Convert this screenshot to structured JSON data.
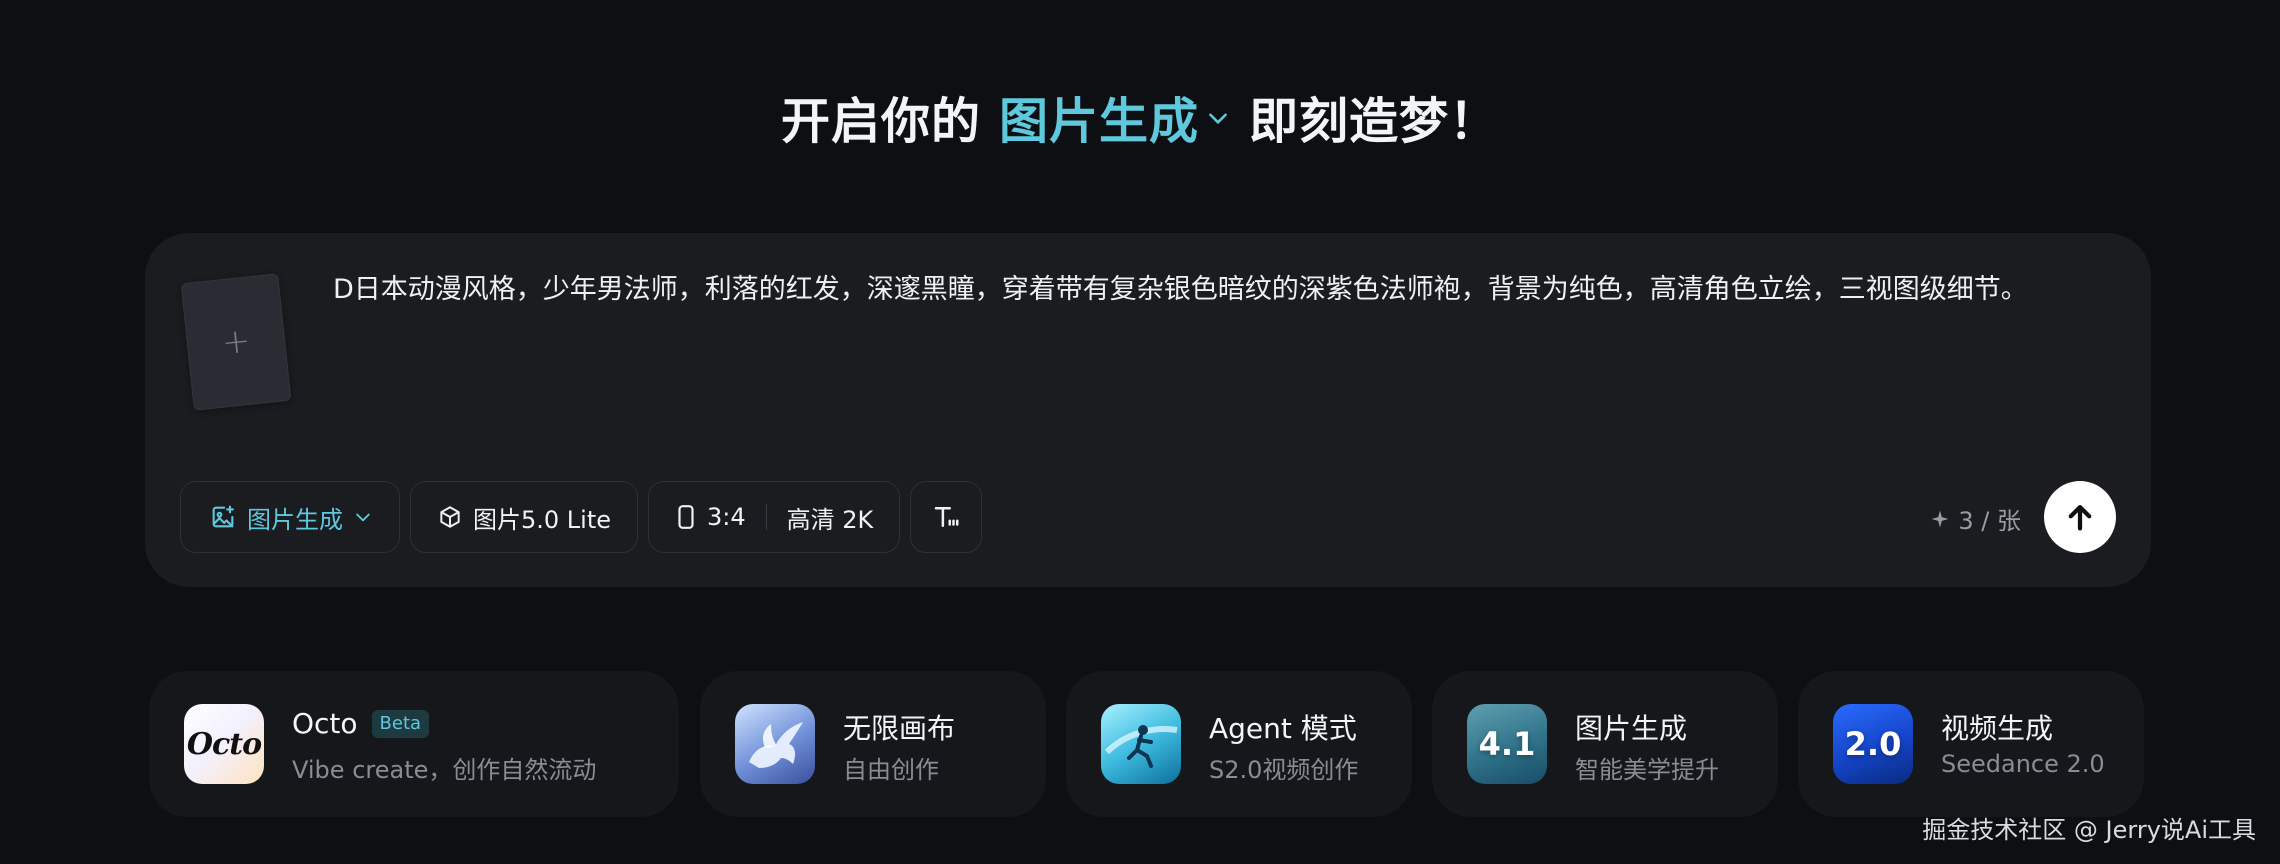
{
  "headline": {
    "prefix": "开启你的",
    "mode": "图片生成",
    "suffix": "即刻造梦！"
  },
  "prompt": {
    "upload_icon": "plus-icon",
    "text": "D日本动漫风格，少年男法师，利落的红发，深邃黑瞳，穿着带有复杂银色暗纹的深紫色法师袍，背景为纯色，高清角色立绘，三视图级细节。"
  },
  "toolbar": {
    "mode_label": "图片生成",
    "mode_icon": "image-sparkle-icon",
    "model_label": "图片5.0 Lite",
    "model_icon": "cube-icon",
    "ratio_label": "3:4",
    "ratio_icon": "portrait-frame-icon",
    "quality_label": "高清 2K",
    "text_style_icon": "text-format-icon"
  },
  "quota": {
    "icon": "sparkle-icon",
    "label": "3 / 张"
  },
  "send_icon": "arrow-up-icon",
  "features": [
    {
      "title": "Octo",
      "badge": "Beta",
      "subtitle": "Vibe create，创作自然流动",
      "thumb_text": "Octo"
    },
    {
      "title": "无限画布",
      "subtitle": "自由创作"
    },
    {
      "title": "Agent 模式",
      "subtitle": "S2.0视频创作"
    },
    {
      "title": "图片生成",
      "subtitle": "智能美学提升",
      "thumb_text": "4.1"
    },
    {
      "title": "视频生成",
      "subtitle": "Seedance 2.0",
      "thumb_text": "2.0"
    }
  ],
  "watermark": "掘金技术社区 @ Jerry说Ai工具",
  "colors": {
    "accent": "#5fc8dc",
    "background": "#0e0f12",
    "card": "#1b1c20"
  }
}
